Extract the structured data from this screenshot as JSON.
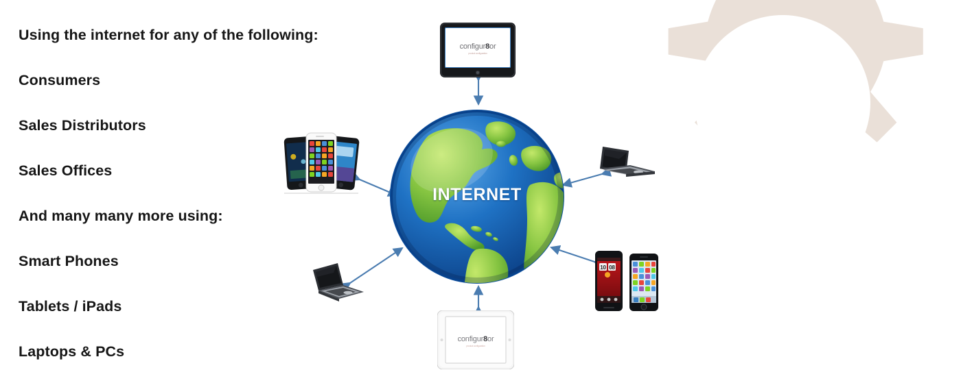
{
  "slide": {
    "background_color": "#ffffff",
    "watermark": {
      "name": "gear-watermark",
      "color": "#EAE0D8"
    }
  },
  "text_column": {
    "lines": [
      {
        "text": "Using the internet for any of the following:"
      },
      {
        "text": "Consumers"
      },
      {
        "text": "Sales Distributors"
      },
      {
        "text": "Sales Offices"
      },
      {
        "text": "And many many more using:"
      },
      {
        "text": "Smart Phones"
      },
      {
        "text": "Tablets / iPads"
      },
      {
        "text": "Laptops & PCs"
      }
    ],
    "text_color": "#161616"
  },
  "hub": {
    "label": "INTERNET",
    "label_color": "#ffffff",
    "ocean_color": "#1C6FC0",
    "land_color": "#7DC242",
    "rim_color": "#0B4FA0"
  },
  "arrows": {
    "color": "#4A7CB0",
    "style": "double-headed",
    "count": 6
  },
  "devices": [
    {
      "id": "tablet-top",
      "name": "tablet-device-top",
      "type": "tablet",
      "bezel_color": "#16181B",
      "screen_color": "#ffffff",
      "logo": "configur8or",
      "logo_accent": "#C0392B"
    },
    {
      "id": "phones-left",
      "name": "smartphone-cluster-left",
      "type": "smartphone-group",
      "phone_count": 3,
      "phones": [
        {
          "body_color": "#15171A",
          "screen": "dark-wallpaper"
        },
        {
          "body_color": "#F2F2F2",
          "screen": "app-grid"
        },
        {
          "body_color": "#15171A",
          "screen": "blue-wallpaper"
        }
      ]
    },
    {
      "id": "laptop-right",
      "name": "laptop-device-right",
      "type": "laptop",
      "body_color": "#3A3D42",
      "screen_color": "#1A1C1F"
    },
    {
      "id": "phones-right",
      "name": "smartphone-pair-right",
      "type": "smartphone-group",
      "phone_count": 2,
      "phones": [
        {
          "body_color": "#101215",
          "screen": "red-clock-widget",
          "clock": "10:08"
        },
        {
          "body_color": "#101215",
          "screen": "app-grid"
        }
      ]
    },
    {
      "id": "ipad-bottom",
      "name": "ipad-device-bottom",
      "type": "tablet",
      "bezel_color": "#F4F4F4",
      "screen_color": "#ffffff",
      "logo": "configur8or",
      "logo_accent": "#C0392B"
    },
    {
      "id": "laptop-left",
      "name": "laptop-device-bottom-left",
      "type": "laptop",
      "body_color": "#3A3D42",
      "screen_color": "#1A1C1F"
    }
  ]
}
